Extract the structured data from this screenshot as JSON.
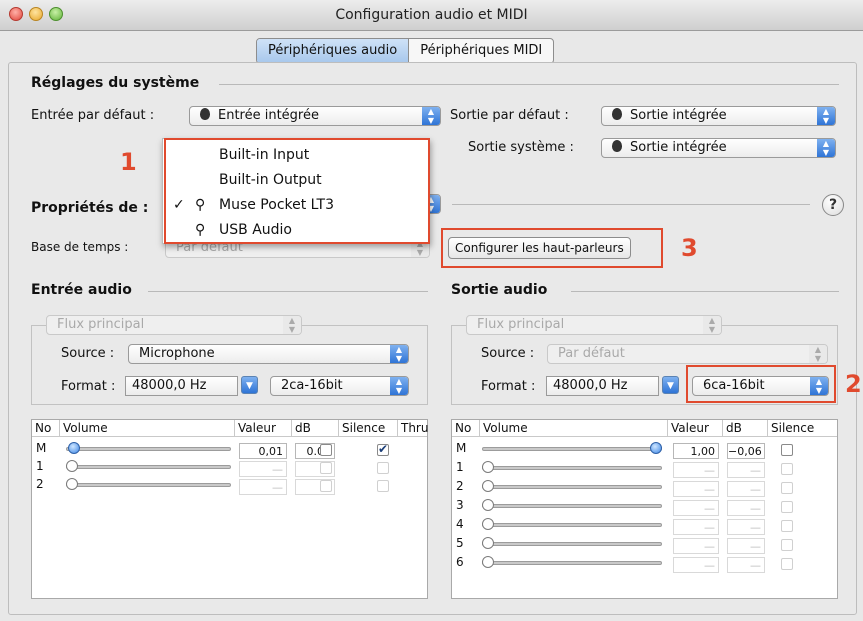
{
  "window": {
    "title": "Configuration audio et MIDI"
  },
  "tabs": [
    "Périphériques audio",
    "Périphériques MIDI"
  ],
  "system": {
    "header": "Réglages du système",
    "input_label": "Entrée par défaut :",
    "input_value": "Entrée intégrée",
    "output_label": "Sortie par défaut :",
    "output_value": "Sortie intégrée",
    "system_output_label": "Sortie système :",
    "system_output_value": "Sortie intégrée"
  },
  "properties": {
    "label": "Propriétés de :",
    "help": "?",
    "timebase_label": "Base de temps :",
    "timebase_value": "Par défaut",
    "speakers_button": "Configurer les haut-parleurs"
  },
  "device_menu": [
    {
      "icon": "apple-icon",
      "glyph": "",
      "label": "Built-in Input",
      "checked": false
    },
    {
      "icon": "apple-icon",
      "glyph": "",
      "label": "Built-in Output",
      "checked": false
    },
    {
      "icon": "usb-icon",
      "glyph": "⚲",
      "label": "Muse Pocket LT3",
      "checked": true,
      "check": "✓"
    },
    {
      "icon": "usb-icon",
      "glyph": "⚲",
      "label": "USB Audio",
      "checked": false
    }
  ],
  "annotations": {
    "one": "1",
    "two": "2",
    "three": "3",
    "color": "#e04a2e"
  },
  "input": {
    "header": "Entrée audio",
    "stream": "Flux principal",
    "source_label": "Source :",
    "source_value": "Microphone",
    "format_label": "Format :",
    "format_rate": "48000,0 Hz",
    "format_bits": "2ca-16bit",
    "columns": [
      "No",
      "Volume",
      "Valeur",
      "dB",
      "Silence",
      "Thru"
    ],
    "rows": [
      {
        "no": "M",
        "value": "0,01",
        "db": "0.00",
        "level": 0.01,
        "thru": true
      },
      {
        "no": "1",
        "value": "—",
        "db": "—",
        "level": 0,
        "thru": false
      },
      {
        "no": "2",
        "value": "—",
        "db": "—",
        "level": 0,
        "thru": false
      }
    ]
  },
  "output": {
    "header": "Sortie audio",
    "stream": "Flux principal",
    "source_label": "Source :",
    "source_value": "Par défaut",
    "format_label": "Format :",
    "format_rate": "48000,0 Hz",
    "format_bits": "6ca-16bit",
    "columns": [
      "No",
      "Volume",
      "Valeur",
      "dB",
      "Silence"
    ],
    "rows": [
      {
        "no": "M",
        "value": "1,00",
        "db": "−0,06",
        "level": 1.0
      },
      {
        "no": "1",
        "value": "—",
        "db": "—",
        "level": 0
      },
      {
        "no": "2",
        "value": "—",
        "db": "—",
        "level": 0
      },
      {
        "no": "3",
        "value": "—",
        "db": "—",
        "level": 0
      },
      {
        "no": "4",
        "value": "—",
        "db": "—",
        "level": 0
      },
      {
        "no": "5",
        "value": "—",
        "db": "—",
        "level": 0
      },
      {
        "no": "6",
        "value": "—",
        "db": "—",
        "level": 0
      }
    ]
  }
}
